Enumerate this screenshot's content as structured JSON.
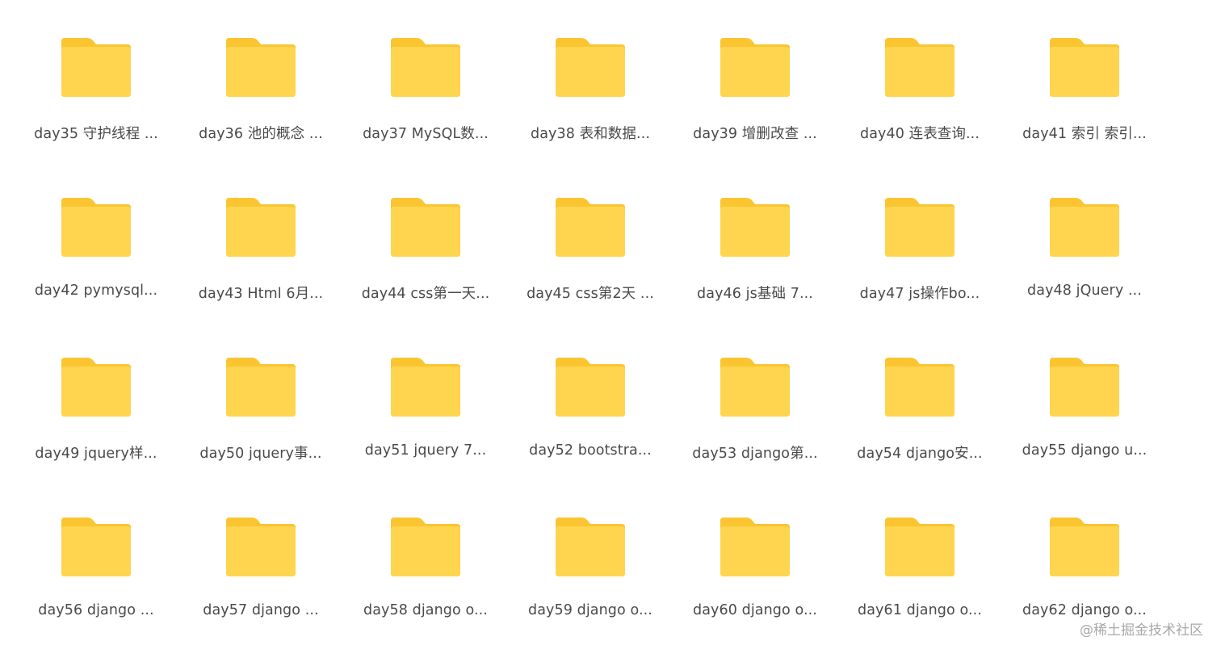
{
  "folder_color": "#FFD54F",
  "folder_tab_color": "#FBC531",
  "icon": "folder-icon",
  "folders": [
    {
      "label": "day35 守护线程 ..."
    },
    {
      "label": "day36 池的概念 ..."
    },
    {
      "label": "day37 MySQL数..."
    },
    {
      "label": "day38 表和数据..."
    },
    {
      "label": "day39 增删改查 ..."
    },
    {
      "label": "day40 连表查询..."
    },
    {
      "label": "day41 索引 索引..."
    },
    {
      "label": "day42 pymysql..."
    },
    {
      "label": "day43 Html 6月..."
    },
    {
      "label": "day44 css第一天..."
    },
    {
      "label": "day45 css第2天 ..."
    },
    {
      "label": "day46  js基础 7..."
    },
    {
      "label": "day47 js操作bo..."
    },
    {
      "label": "day48  jQuery ..."
    },
    {
      "label": "day49  jquery样..."
    },
    {
      "label": "day50  jquery事..."
    },
    {
      "label": "day51 jquery 7..."
    },
    {
      "label": "day52 bootstra..."
    },
    {
      "label": "day53 django第..."
    },
    {
      "label": "day54 django安..."
    },
    {
      "label": "day55 django u..."
    },
    {
      "label": "day56 django ..."
    },
    {
      "label": "day57 django ..."
    },
    {
      "label": "day58 django o..."
    },
    {
      "label": "day59 django o..."
    },
    {
      "label": "day60 django o..."
    },
    {
      "label": "day61 django o..."
    },
    {
      "label": "day62 django o..."
    }
  ],
  "watermark": "@稀土掘金技术社区"
}
